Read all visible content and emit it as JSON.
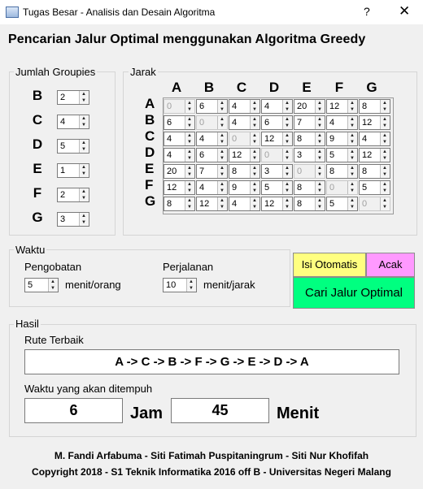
{
  "window": {
    "title": "Tugas Besar - Analisis dan Desain Algoritma",
    "help_label": "?",
    "close_label": "✕"
  },
  "heading": "Pencarian Jalur Optimal menggunakan Algoritma Greedy",
  "groupies": {
    "legend": "Jumlah Groupies",
    "rows": [
      {
        "label": "B",
        "value": "2"
      },
      {
        "label": "C",
        "value": "4"
      },
      {
        "label": "D",
        "value": "5"
      },
      {
        "label": "E",
        "value": "1"
      },
      {
        "label": "F",
        "value": "2"
      },
      {
        "label": "G",
        "value": "3"
      }
    ]
  },
  "jarak": {
    "legend": "Jarak",
    "columns": [
      "A",
      "B",
      "C",
      "D",
      "E",
      "F",
      "G"
    ],
    "rows": [
      "A",
      "B",
      "C",
      "D",
      "E",
      "F",
      "G"
    ],
    "matrix": [
      [
        "0",
        "6",
        "4",
        "4",
        "20",
        "12",
        "8"
      ],
      [
        "6",
        "0",
        "4",
        "6",
        "7",
        "4",
        "12"
      ],
      [
        "4",
        "4",
        "0",
        "12",
        "8",
        "9",
        "4"
      ],
      [
        "4",
        "6",
        "12",
        "0",
        "3",
        "5",
        "12"
      ],
      [
        "20",
        "7",
        "8",
        "3",
        "0",
        "8",
        "8"
      ],
      [
        "12",
        "4",
        "9",
        "5",
        "8",
        "0",
        "5"
      ],
      [
        "8",
        "12",
        "4",
        "12",
        "8",
        "5",
        "0"
      ]
    ]
  },
  "waktu": {
    "legend": "Waktu",
    "pengobatan_label": "Pengobatan",
    "pengobatan_value": "5",
    "pengobatan_unit": "menit/orang",
    "perjalanan_label": "Perjalanan",
    "perjalanan_value": "10",
    "perjalanan_unit": "menit/jarak"
  },
  "buttons": {
    "isi_otomatis": "Isi Otomatis",
    "acak": "Acak",
    "cari": "Cari Jalur Optimal"
  },
  "hasil": {
    "legend": "Hasil",
    "rute_label": "Rute Terbaik",
    "rute_value": "A -> C -> B -> F -> G -> E -> D -> A",
    "waktu_label": "Waktu yang akan ditempuh",
    "jam_value": "6",
    "jam_label": "Jam",
    "menit_value": "45",
    "menit_label": "Menit"
  },
  "footer": {
    "authors": "M. Fandi Arfabuma - Siti Fatimah Puspitaningrum - Siti Nur Khofifah",
    "copyright": "Copyright 2018 - S1 Teknik Informatika 2016 off B - Universitas Negeri Malang"
  },
  "colors": {
    "isi_otomatis_bg": "#ffff80",
    "acak_bg": "#ff99ff",
    "cari_bg": "#00ff80"
  }
}
